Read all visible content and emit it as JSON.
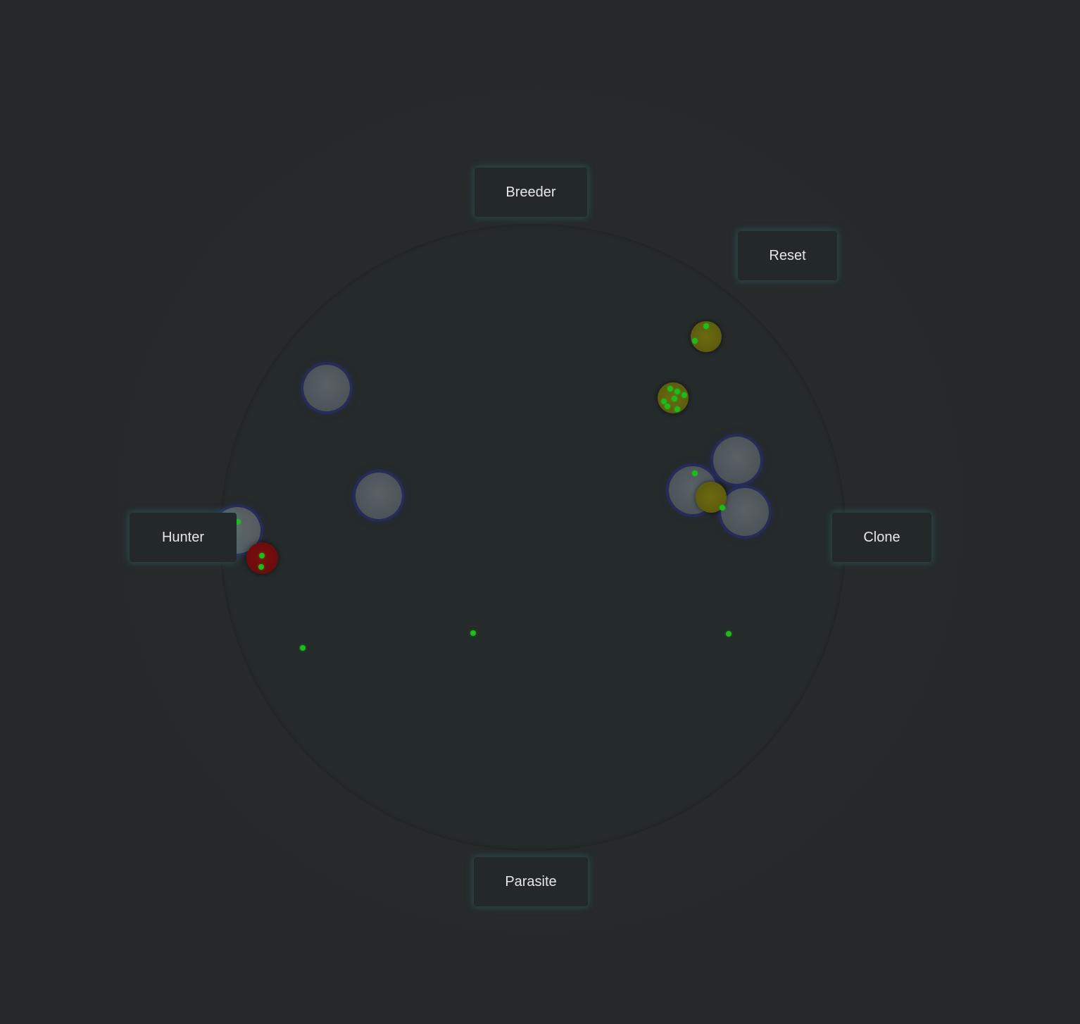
{
  "controls": {
    "breeder": "Breeder",
    "reset": "Reset",
    "hunter": "Hunter",
    "clone": "Clone",
    "parasite": "Parasite"
  },
  "colors": {
    "background": "#26292b",
    "cell": "#50575c",
    "cell_glow": "#282d6e",
    "food": "#1bbd1b",
    "yellow_blob": "#5c5a0d",
    "red_blob": "#6a0b0b",
    "button_glow": "#3ca096"
  }
}
